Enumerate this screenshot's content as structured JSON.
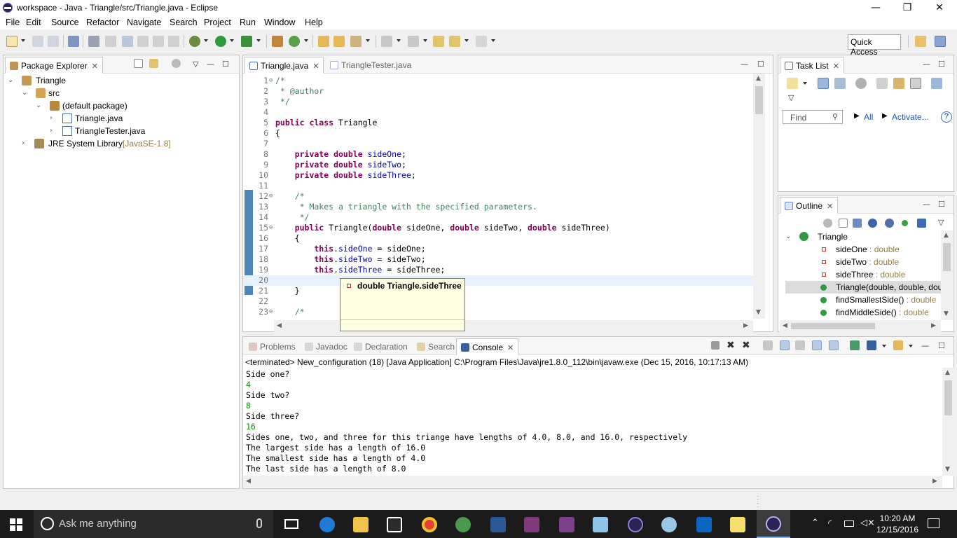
{
  "window": {
    "title": "workspace - Java - Triangle/src/Triangle.java - Eclipse",
    "controls": [
      "—",
      "❐",
      "✕"
    ]
  },
  "menu": [
    "File",
    "Edit",
    "Source",
    "Refactor",
    "Navigate",
    "Search",
    "Project",
    "Run",
    "Window",
    "Help"
  ],
  "toolbar": {
    "quick_access": "Quick Access"
  },
  "package_explorer": {
    "tab": "Package Explorer",
    "tree": [
      {
        "label": "Triangle",
        "extra": ""
      },
      {
        "label": "src",
        "extra": ""
      },
      {
        "label": "(default package)",
        "extra": ""
      },
      {
        "label": "Triangle.java",
        "extra": ""
      },
      {
        "label": "TriangleTester.java",
        "extra": ""
      },
      {
        "label": "JRE System Library",
        "extra": "[JavaSE-1.8]"
      }
    ]
  },
  "editor": {
    "tabs": [
      "Triangle.java",
      "TriangleTester.java"
    ],
    "hover": "double Triangle.sideThree",
    "lines": [
      {
        "n": "1",
        "fold": "⊖",
        "parts": [
          {
            "t": "/*",
            "c": "cm"
          }
        ]
      },
      {
        "n": "2",
        "fold": "",
        "parts": [
          {
            "t": " * @author",
            "c": "cm"
          }
        ]
      },
      {
        "n": "3",
        "fold": "",
        "parts": [
          {
            "t": " */",
            "c": "cm"
          }
        ]
      },
      {
        "n": "4",
        "fold": "",
        "parts": []
      },
      {
        "n": "5",
        "fold": "",
        "parts": [
          {
            "t": "public class ",
            "c": "kw"
          },
          {
            "t": "Triangle",
            "c": ""
          }
        ]
      },
      {
        "n": "6",
        "fold": "",
        "parts": [
          {
            "t": "{",
            "c": ""
          }
        ]
      },
      {
        "n": "7",
        "fold": "",
        "parts": []
      },
      {
        "n": "8",
        "fold": "",
        "parts": [
          {
            "t": "    private double ",
            "c": "kw"
          },
          {
            "t": "sideOne",
            "c": "fd"
          },
          {
            "t": ";",
            "c": ""
          }
        ]
      },
      {
        "n": "9",
        "fold": "",
        "parts": [
          {
            "t": "    private double ",
            "c": "kw"
          },
          {
            "t": "sideTwo",
            "c": "fd"
          },
          {
            "t": ";",
            "c": ""
          }
        ]
      },
      {
        "n": "10",
        "fold": "",
        "parts": [
          {
            "t": "    private double ",
            "c": "kw"
          },
          {
            "t": "sideThree",
            "c": "fd"
          },
          {
            "t": ";",
            "c": ""
          }
        ]
      },
      {
        "n": "11",
        "fold": "",
        "parts": []
      },
      {
        "n": "12",
        "fold": "⊖",
        "parts": [
          {
            "t": "    /*",
            "c": "cm"
          }
        ]
      },
      {
        "n": "13",
        "fold": "",
        "parts": [
          {
            "t": "     * Makes a triangle with the specified parameters.",
            "c": "cm"
          }
        ]
      },
      {
        "n": "14",
        "fold": "",
        "parts": [
          {
            "t": "     */",
            "c": "cm"
          }
        ]
      },
      {
        "n": "15",
        "fold": "⊖",
        "parts": [
          {
            "t": "    public ",
            "c": "kw"
          },
          {
            "t": "Triangle(",
            "c": ""
          },
          {
            "t": "double ",
            "c": "kw"
          },
          {
            "t": "sideOne, ",
            "c": ""
          },
          {
            "t": "double ",
            "c": "kw"
          },
          {
            "t": "sideTwo, ",
            "c": ""
          },
          {
            "t": "double ",
            "c": "kw"
          },
          {
            "t": "sideThree)",
            "c": ""
          }
        ]
      },
      {
        "n": "16",
        "fold": "",
        "parts": [
          {
            "t": "    {",
            "c": ""
          }
        ]
      },
      {
        "n": "17",
        "fold": "",
        "parts": [
          {
            "t": "        this",
            "c": "kw"
          },
          {
            "t": ".",
            "c": ""
          },
          {
            "t": "sideOne",
            "c": "fd"
          },
          {
            "t": " = sideOne;",
            "c": ""
          }
        ]
      },
      {
        "n": "18",
        "fold": "",
        "parts": [
          {
            "t": "        this",
            "c": "kw"
          },
          {
            "t": ".",
            "c": ""
          },
          {
            "t": "sideTwo",
            "c": "fd"
          },
          {
            "t": " = sideTwo;",
            "c": ""
          }
        ]
      },
      {
        "n": "19",
        "fold": "",
        "parts": [
          {
            "t": "        this",
            "c": "kw"
          },
          {
            "t": ".",
            "c": ""
          },
          {
            "t": "sideThree",
            "c": "fd"
          },
          {
            "t": " = sideThree;",
            "c": ""
          }
        ]
      },
      {
        "n": "20",
        "fold": "",
        "parts": []
      },
      {
        "n": "21",
        "fold": "",
        "parts": [
          {
            "t": "    }",
            "c": ""
          }
        ]
      },
      {
        "n": "22",
        "fold": "",
        "parts": []
      },
      {
        "n": "23",
        "fold": "⊖",
        "parts": [
          {
            "t": "    /*",
            "c": "cm"
          }
        ]
      }
    ]
  },
  "task_list": {
    "tab": "Task List",
    "find_placeholder": "Find",
    "all": "All",
    "activate": "Activate..."
  },
  "outline": {
    "tab": "Outline",
    "root": "Triangle",
    "items": [
      {
        "name": "sideOne",
        "type": " : double"
      },
      {
        "name": "sideTwo",
        "type": " : double"
      },
      {
        "name": "sideThree",
        "type": " : double"
      },
      {
        "name": "Triangle(double, double, dou",
        "type": ""
      },
      {
        "name": "findSmallestSide()",
        "type": " : double"
      },
      {
        "name": "findMiddleSide()",
        "type": " : double"
      }
    ]
  },
  "bottom": {
    "tabs": [
      "Problems",
      "Javadoc",
      "Declaration",
      "Search",
      "Console"
    ],
    "header": "<terminated> New_configuration (18) [Java Application] C:\\Program Files\\Java\\jre1.8.0_112\\bin\\javaw.exe (Dec 15, 2016, 10:17:13 AM)",
    "lines": [
      {
        "t": "Side one?",
        "in": false
      },
      {
        "t": "4",
        "in": true
      },
      {
        "t": "Side two?",
        "in": false
      },
      {
        "t": "8",
        "in": true
      },
      {
        "t": "Side three?",
        "in": false
      },
      {
        "t": "16",
        "in": true
      },
      {
        "t": "Sides one, two, and three for this triange have lengths of 4.0, 8.0, and 16.0, respectively",
        "in": false
      },
      {
        "t": "The largest side has a length of 16.0",
        "in": false
      },
      {
        "t": "The smallest side has a length of 4.0",
        "in": false
      },
      {
        "t": "The last side has a length of 8.0",
        "in": false
      }
    ]
  },
  "taskbar": {
    "search": "Ask me anything",
    "time": "10:20 AM",
    "date": "12/15/2016"
  }
}
